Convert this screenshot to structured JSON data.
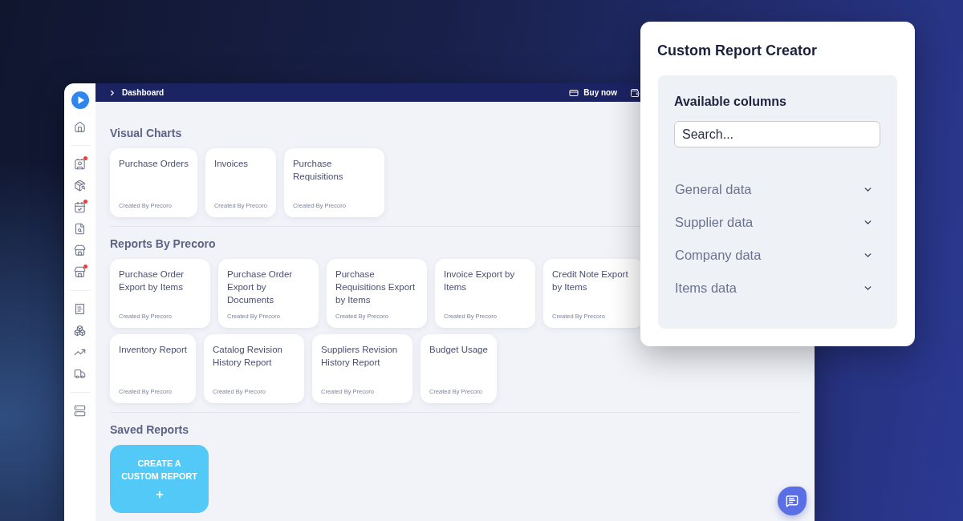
{
  "app": {
    "sidebar": {
      "groups": [
        {
          "items": [
            {
              "kind": "home",
              "badge": false
            }
          ]
        },
        {
          "items": [
            {
              "kind": "contact",
              "badge": true
            },
            {
              "kind": "package",
              "badge": false
            },
            {
              "kind": "calendar",
              "badge": true
            },
            {
              "kind": "file",
              "badge": false
            },
            {
              "kind": "store",
              "badge": false
            },
            {
              "kind": "store",
              "badge": true
            }
          ]
        },
        {
          "items": [
            {
              "kind": "receipt",
              "badge": false
            },
            {
              "kind": "boxes",
              "badge": false
            },
            {
              "kind": "chart",
              "badge": false
            },
            {
              "kind": "truck",
              "badge": false
            }
          ]
        },
        {
          "items": [
            {
              "kind": "server",
              "badge": false
            }
          ]
        }
      ]
    },
    "top_bar": {
      "breadcrumb": "Dashboard",
      "buy_now": "Buy now"
    },
    "sections": [
      {
        "kind": "cards",
        "title": "Visual Charts",
        "cards": [
          {
            "title": "Purchase Orders",
            "author": "Created By Precoro"
          },
          {
            "title": "Invoices",
            "author": "Created By Precoro"
          },
          {
            "title": "Purchase Requisitions",
            "author": "Created By Precoro"
          }
        ]
      },
      {
        "kind": "cards",
        "title": "Reports By Precoro",
        "cards": [
          {
            "title": "Purchase Order Export by Items",
            "author": "Created By Precoro"
          },
          {
            "title": "Purchase Order Export by Documents",
            "author": "Created By Precoro"
          },
          {
            "title": "Purchase Requisitions Export by Items",
            "author": "Created By Precoro"
          },
          {
            "title": "Invoice Export by Items",
            "author": "Created By Precoro"
          },
          {
            "title": "Credit Note Export by Items",
            "author": "Created By Precoro"
          },
          {
            "title": "Inventory Report",
            "author": "Created By Precoro"
          },
          {
            "title": "Catalog Revision History Report",
            "author": "Created By Precoro"
          },
          {
            "title": "Suppliers Revision History Report",
            "author": "Created By Precoro"
          },
          {
            "title": "Budget Usage",
            "author": "Created By Precoro"
          }
        ]
      },
      {
        "kind": "create",
        "title": "Saved Reports",
        "button": "CREATE A CUSTOM REPORT"
      }
    ]
  },
  "custom_report_creator": {
    "title": "Custom Report Creator",
    "panel_title": "Available columns",
    "search": {
      "placeholder": "Search..."
    },
    "groups": [
      {
        "label": "General data",
        "expanded": false
      },
      {
        "label": "Supplier data",
        "expanded": false
      },
      {
        "label": "Company data",
        "expanded": false
      },
      {
        "label": "Items data",
        "expanded": false
      }
    ]
  }
}
